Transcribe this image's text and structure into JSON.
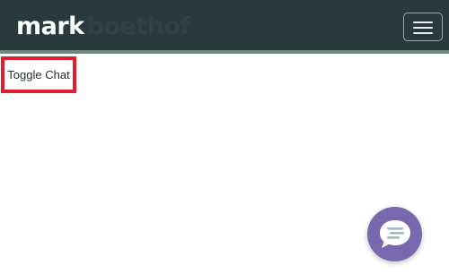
{
  "navbar": {
    "brand_primary": "mark",
    "brand_secondary": "boethof",
    "background_color": "#273b3e",
    "accent_border_color": "#6b8a7c",
    "menu_icon": "hamburger-menu-icon"
  },
  "main": {
    "toggle_chat_label": "Toggle Chat",
    "highlight_color": "#e01e2d"
  },
  "chat_widget": {
    "icon": "chat-bubble-icon",
    "color": "#7868ad"
  }
}
